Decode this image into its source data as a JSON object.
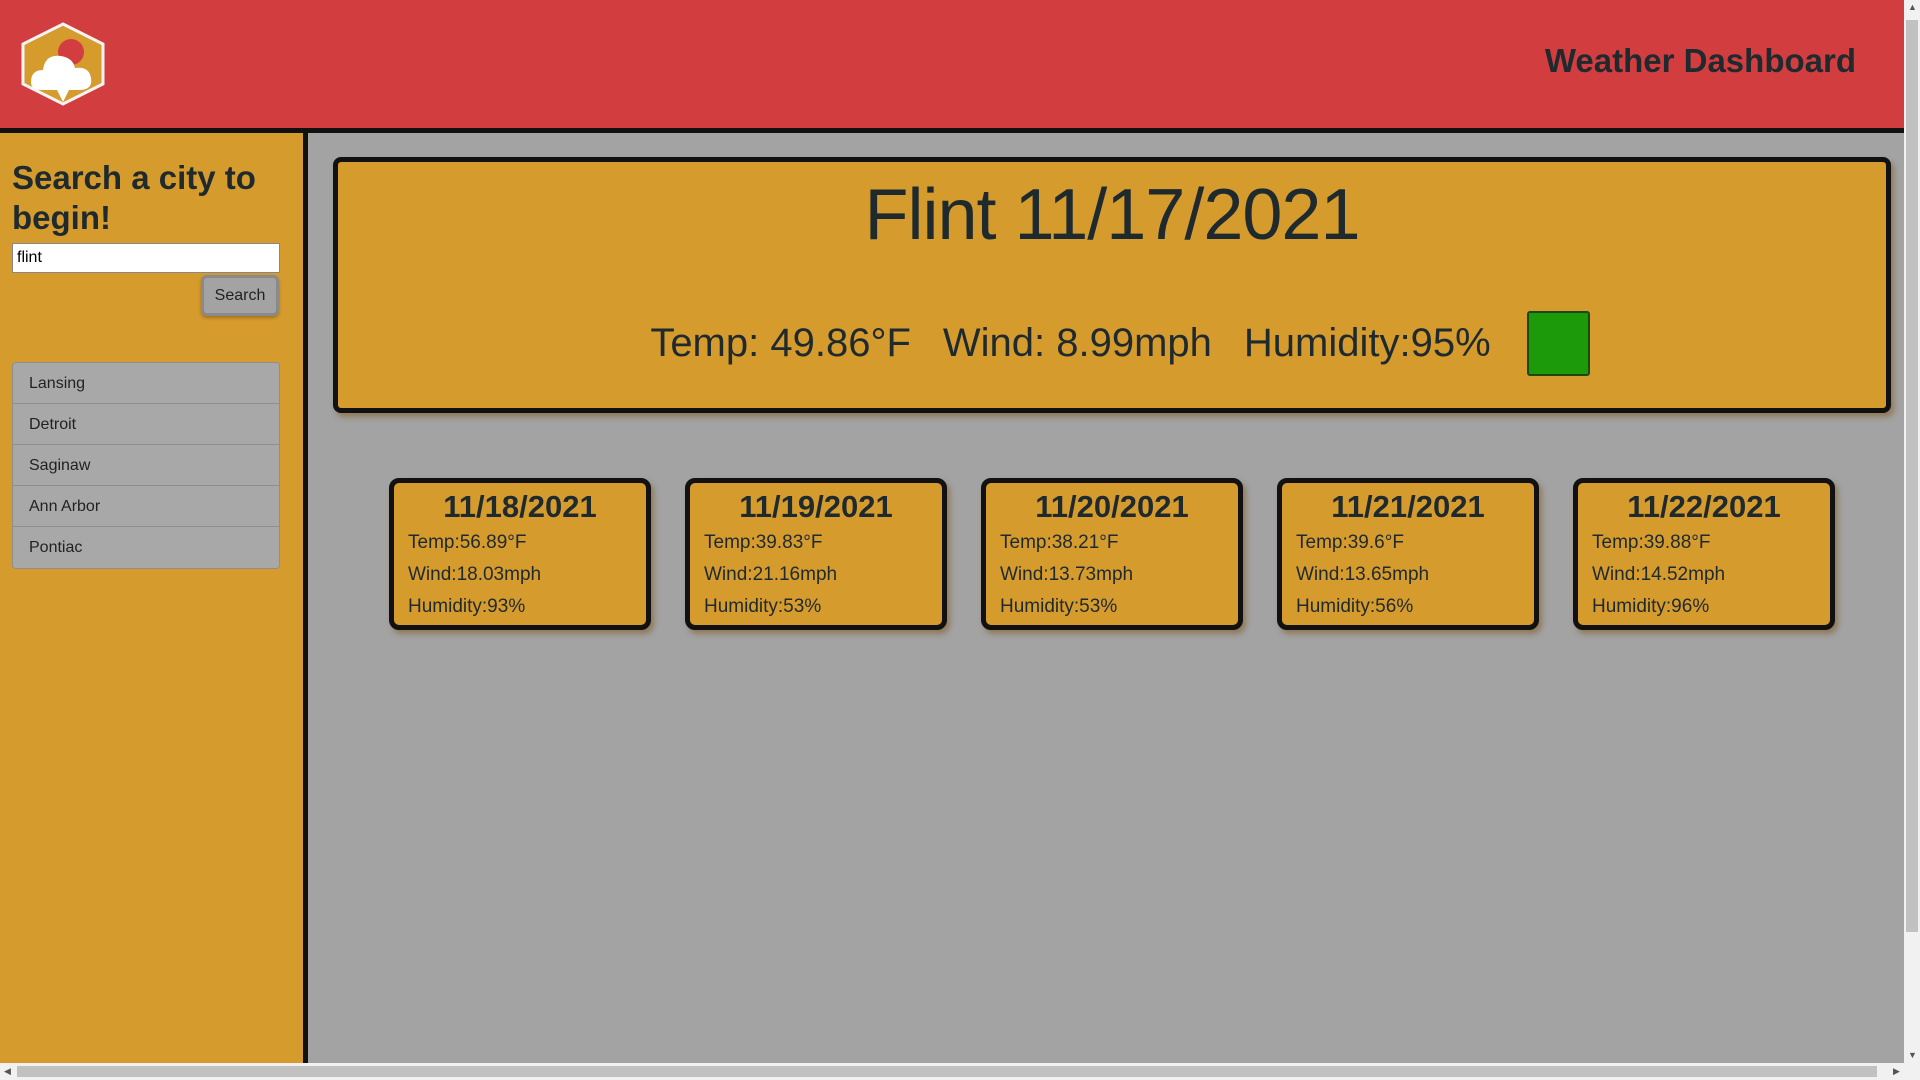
{
  "header": {
    "title": "Weather Dashboard",
    "logo_icon": "weather-logo-icon"
  },
  "sidebar": {
    "heading": "Search a city to begin!",
    "search_value": "flint",
    "search_button": "Search",
    "history": [
      "Lansing",
      "Detroit",
      "Saginaw",
      "Ann Arbor",
      "Pontiac"
    ]
  },
  "current": {
    "title": "Flint 11/17/2021",
    "temp": "Temp: 49.86°F",
    "wind": "Wind: 8.99mph",
    "humidity": "Humidity:95%",
    "uv_color": "#1c9a09"
  },
  "forecast": [
    {
      "date": "11/18/2021",
      "temp": "Temp:56.89°F",
      "wind": "Wind:18.03mph",
      "humidity": "Humidity:93%"
    },
    {
      "date": "11/19/2021",
      "temp": "Temp:39.83°F",
      "wind": "Wind:21.16mph",
      "humidity": "Humidity:53%"
    },
    {
      "date": "11/20/2021",
      "temp": "Temp:38.21°F",
      "wind": "Wind:13.73mph",
      "humidity": "Humidity:53%"
    },
    {
      "date": "11/21/2021",
      "temp": "Temp:39.6°F",
      "wind": "Wind:13.65mph",
      "humidity": "Humidity:56%"
    },
    {
      "date": "11/22/2021",
      "temp": "Temp:39.88°F",
      "wind": "Wind:14.52mph",
      "humidity": "Humidity:96%"
    }
  ],
  "colors": {
    "header": "#d23d40",
    "sidebar": "#d69b2d",
    "content": "#a3a3a3",
    "card": "#d69b2d",
    "uv_good": "#1c9a09"
  }
}
